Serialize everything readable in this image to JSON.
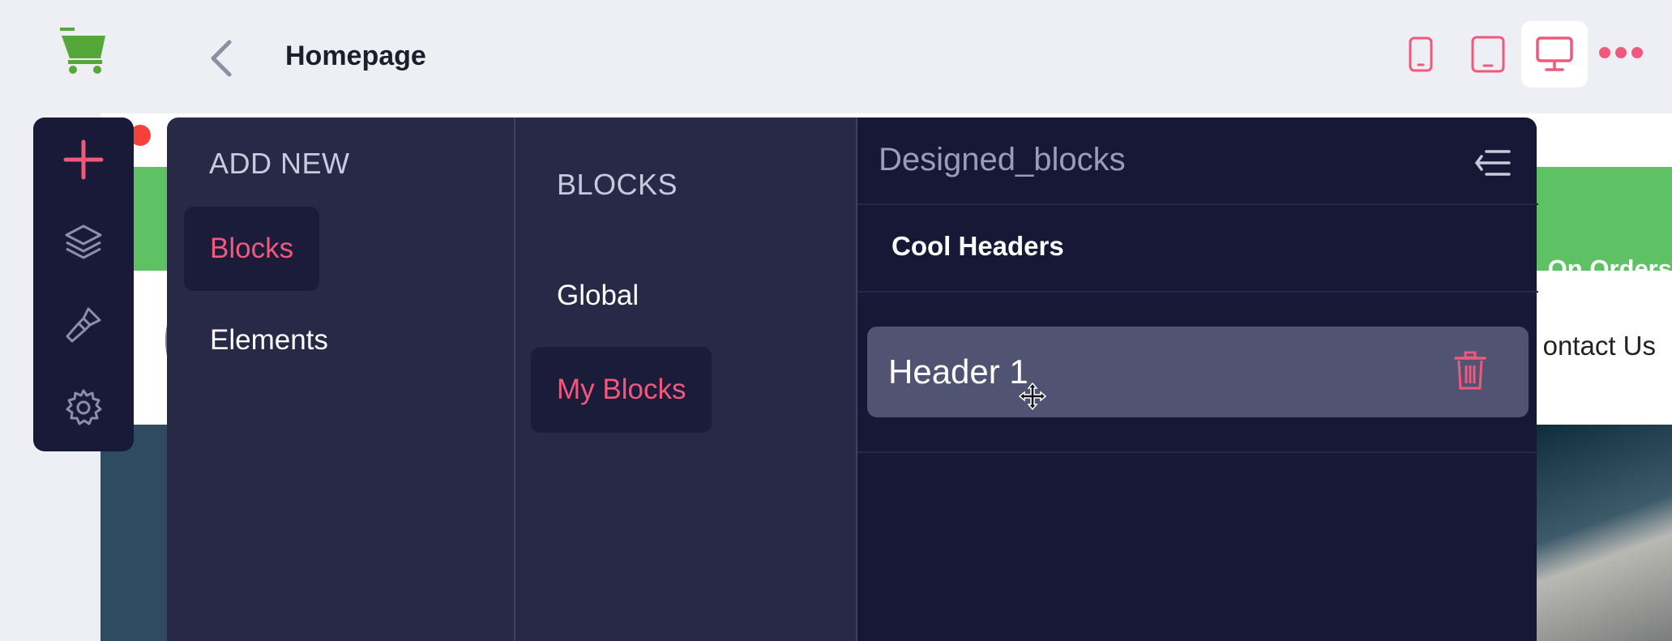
{
  "header": {
    "title": "Homepage",
    "logo_icon": "shopping-cart-icon",
    "back_icon": "chevron-left-icon",
    "devices": [
      {
        "name": "phone",
        "icon": "smartphone-icon",
        "active": false
      },
      {
        "name": "tablet",
        "icon": "tablet-icon",
        "active": false
      },
      {
        "name": "desktop",
        "icon": "monitor-icon",
        "active": true
      }
    ],
    "more_icon": "more-horizontal-icon"
  },
  "canvas": {
    "promo_text": "On Orders",
    "contact_text": "ontact Us"
  },
  "rail": {
    "items": [
      {
        "icon": "plus-icon"
      },
      {
        "icon": "layers-icon"
      },
      {
        "icon": "brush-icon"
      },
      {
        "icon": "gear-icon"
      }
    ]
  },
  "add_new": {
    "title": "ADD NEW",
    "items": [
      {
        "label": "Blocks",
        "active": true
      },
      {
        "label": "Elements",
        "active": false
      }
    ]
  },
  "blocks": {
    "title": "BLOCKS",
    "items": [
      {
        "label": "Global",
        "active": false
      },
      {
        "label": "My Blocks",
        "active": true
      }
    ]
  },
  "designed": {
    "title": "Designed_blocks",
    "collapse_icon": "collapse-menu-icon",
    "group": "Cool Headers",
    "block": {
      "name": "Header 1",
      "delete_icon": "trash-icon"
    }
  },
  "colors": {
    "accent": "#f0587c",
    "panel_dark": "#161836",
    "panel": "#282947",
    "rail": "#181a37",
    "logo_green": "#55a838"
  }
}
